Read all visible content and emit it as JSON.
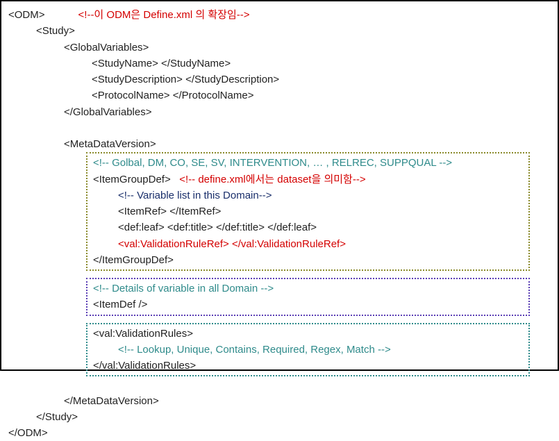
{
  "lines": {
    "odm_open": "<ODM>",
    "odm_open_comment": "<!--이 ODM은 Define.xml 의 확장임-->",
    "study_open": "<Study>",
    "gv_open": "<GlobalVariables>",
    "studyname": "<StudyName> </StudyName>",
    "studydesc": "<StudyDescription> </StudyDescription>",
    "protocol": "<ProtocolName> </ProtocolName>",
    "gv_close": "</GlobalVariables>",
    "mdv_open": "<MetaDataVersion>",
    "mdv_close": "</MetaDataVersion>",
    "study_close": "</Study>",
    "odm_close": "</ODM>"
  },
  "box1": {
    "c1": "<!-- Golbal, DM, CO, SE, SV, INTERVENTION, … , RELREC, SUPPQUAL -->",
    "igd_open": "<ItemGroupDef>",
    "igd_open_comment": "<!-- define.xml에서는 dataset을 의미함-->",
    "varlist_comment": "<!-- Variable list in this Domain-->",
    "itemref": "<ItemRef> </ItemRef>",
    "defleaf": "<def:leaf> <def:title> </def:title> </def:leaf>",
    "val_ref": "<val:ValidationRuleRef> </val:ValidationRuleRef>",
    "igd_close": "</ItemGroupDef>"
  },
  "box2": {
    "c1": "<!-- Details of variable in all Domain -->",
    "itemdef": "<ItemDef />"
  },
  "box3": {
    "vr_open": "<val:ValidationRules>",
    "c1": "<!-- Lookup, Unique, Contains, Required, Regex, Match -->",
    "vr_close": "</val:ValidationRules>"
  }
}
